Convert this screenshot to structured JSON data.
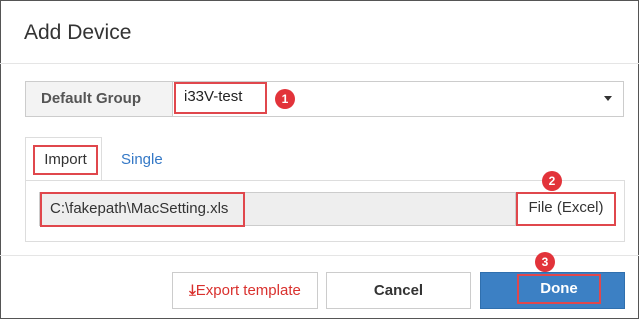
{
  "dialog": {
    "title": "Add Device"
  },
  "default_group": {
    "label": "Default Group",
    "selected_value": "i33V-test"
  },
  "tabs": [
    {
      "label": "Import",
      "active": true
    },
    {
      "label": "Single",
      "active": false
    }
  ],
  "import": {
    "file_path": "C:\\fakepath\\MacSetting.xls",
    "file_button_label": "File (Excel)"
  },
  "footer": {
    "export_label": "Export template",
    "export_icon": "download-arrow-icon",
    "cancel_label": "Cancel",
    "done_label": "Done"
  },
  "step_markers": [
    "1",
    "2",
    "3"
  ],
  "colors": {
    "highlight": "#e0474c",
    "primary": "#3c80c4",
    "link": "#3478c6",
    "export_text": "#d9312e"
  }
}
